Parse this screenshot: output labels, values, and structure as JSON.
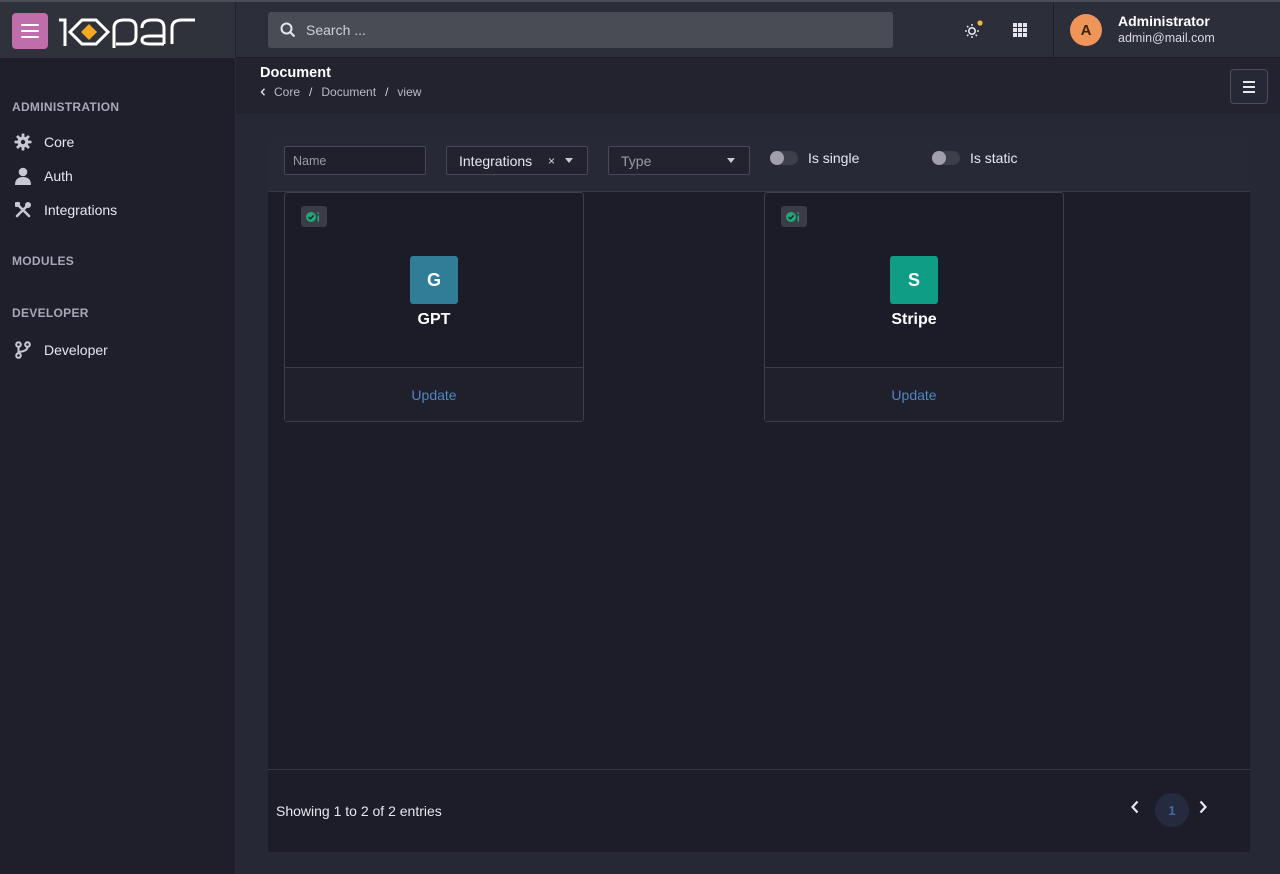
{
  "app": {
    "brand": "1o-par",
    "search_placeholder": "Search ...",
    "menu_icon": "hamburger-icon",
    "theme_icon": "sun-icon",
    "apps_icon": "grid-icon"
  },
  "user": {
    "initial": "A",
    "name": "Administrator",
    "email": "admin@mail.com",
    "avatar_color": "#f0955a"
  },
  "sidebar": {
    "sections": [
      {
        "title": "ADMINISTRATION"
      },
      {
        "title": "MODULES"
      },
      {
        "title": "DEVELOPER"
      }
    ],
    "items": [
      {
        "label": "Core",
        "icon": "gear-icon"
      },
      {
        "label": "Auth",
        "icon": "user-icon"
      },
      {
        "label": "Integrations",
        "icon": "tools-icon"
      },
      {
        "label": "Developer",
        "icon": "branch-icon"
      }
    ]
  },
  "page": {
    "title": "Document",
    "breadcrumb": [
      "Core",
      "Document",
      "view"
    ],
    "breadcrumb_sep": "/"
  },
  "filters": {
    "name_placeholder": "Name",
    "integration_value": "Integrations",
    "integration_clear": "×",
    "type_placeholder": "Type",
    "is_single_label": "Is single",
    "is_single": false,
    "is_static_label": "Is static",
    "is_static": false
  },
  "cards": [
    {
      "letter": "G",
      "name": "GPT",
      "action": "Update",
      "color": "#2f7d96"
    },
    {
      "letter": "S",
      "name": "Stripe",
      "action": "Update",
      "color": "#0f9d86"
    }
  ],
  "pagination": {
    "summary": "Showing 1 to 2 of 2 entries",
    "current_page": "1"
  },
  "colors": {
    "accent_menu": "#c06dab",
    "link": "#4e86c8",
    "status_check": "#1ea876"
  }
}
